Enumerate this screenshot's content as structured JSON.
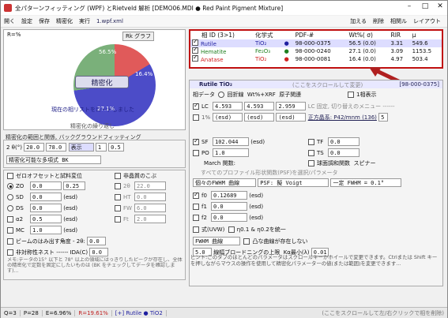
{
  "window": {
    "title": "全パターンフィッティング (WPF) とRietveld 解析 [DEMO06.MDI ● Red Paint Pigment Mixture]"
  },
  "menu": {
    "items": [
      "開く",
      "設定",
      "保存",
      "精密化",
      "実行",
      "1.wpf.xml"
    ],
    "right": [
      "加える",
      "削除",
      "相関ル",
      "レイアウト"
    ]
  },
  "left": {
    "r_label": "R=%",
    "mode": "Rk グラフ",
    "pct1": "56.5%",
    "pct2": "27.1%",
    "pct3": "16.4%",
    "refine_btn": "精密化",
    "loaded_msg": "現在の相リストをロードしました",
    "footer": "精密化の繰り返し"
  },
  "refine_section": {
    "title": "精密化の範囲と関係, バックグラウンドフィッティング",
    "theta_label": "2 θ(°)",
    "theta_from": "20.0",
    "theta_to": "78.0",
    "display_btn": "表示",
    "val1": "1",
    "val2": "0.5",
    "refine_cb": "精密化可能な多項式 BK",
    "zero_label": "ゼロオフセットと試料変位",
    "nonsym_label": "非晶質のこぶ"
  },
  "params_left": [
    {
      "name": "ZO",
      "val": "0.0",
      "val2": "0.25"
    },
    {
      "name": "SD",
      "val": "0.0",
      "val2": "(esd)"
    },
    {
      "name": "DS",
      "val": "0.0",
      "val2": "(esd)"
    },
    {
      "name": "α2",
      "val": "0.5",
      "val2": "(esd)"
    },
    {
      "name": "MC",
      "val": "1.0",
      "val2": "(esd)"
    }
  ],
  "amorph": [
    {
      "name": "2θ",
      "val": "22.0"
    },
    {
      "name": "HT",
      "val": "0.0"
    },
    {
      "name": "FW",
      "val": "6.0"
    },
    {
      "name": "Ft",
      "val": "2.0"
    }
  ],
  "beam_label": "ビームのはみ出す角度 - 2θ:",
  "beam_val": "0.0",
  "sym_label": "非対称性ネスト ------ IDA(C)",
  "sym_val": "0.0",
  "left_note": "メモ:データの15° 以下と 78° 以上の領域にはっきりしたピークが存在し、全体の精密化で定数を固定にしたいものは (BK をチェックしてデータを確認します)...",
  "phase_table": {
    "headers": [
      "相 ID (3>1)",
      "化学式",
      "",
      "PDF-#",
      "Wt%( σ)",
      "RIR",
      "μ"
    ],
    "rows": [
      {
        "name": "Rutile",
        "formula": "TiO₂",
        "pdf": "98-000-0375",
        "wt": "56.5 (0.0)",
        "rir": "3.31",
        "mu": "549.6",
        "color": "#1f1fa0"
      },
      {
        "name": "Hematite",
        "formula": "Fe₂O₃",
        "pdf": "98-000-0240",
        "wt": "27.1 (0.0)",
        "rir": "3.09",
        "mu": "1153.5",
        "color": "#1f7f1f"
      },
      {
        "name": "Anatase",
        "formula": "TiO₂",
        "pdf": "98-000-0081",
        "wt": "16.4 (0.0)",
        "rir": "4.97",
        "mu": "503.4",
        "color": "#d02020"
      }
    ]
  },
  "rpanel": {
    "phase_label": "Rutile TiO₂",
    "hint": "(ここをスクロールして変更)",
    "pdf": "[98-000-0375]",
    "tabs": [
      "相データ",
      "回折線",
      "Wt%+XRF",
      "原子関連"
    ],
    "one_display": "1相表示",
    "lc_label": "LC",
    "lc_vals": [
      "4.593",
      "4.593",
      "2.959"
    ],
    "lc_note": "LC 固定, 切り替えのメニュー ------",
    "esd": "(esd)",
    "sg": "正方晶系: P42/mnm (136)",
    "sg_n": "5",
    "sf_label": "SF",
    "sf_val": "102.044",
    "po_label": "PO",
    "po_val": "1.0",
    "tf_label": "TF",
    "tf_val": "0.0",
    "ts_label": "TS",
    "ts_val": "0.0",
    "march": "March 関数:",
    "spinel": "球面調和関数",
    "spin": "スピナー",
    "profile_title": "すべてのプロファイル形状関数(PSF)を選択/パラメータ",
    "shape_sel": "個々のFWHM 曲線",
    "psf": "PSF: 擬 Voigt",
    "fwhm": "一定 FWHM = 0.1°",
    "f_rows": [
      {
        "n": "f0",
        "v": "0.12689"
      },
      {
        "n": "f1",
        "v": "0.0"
      },
      {
        "n": "f2",
        "v": "0.0"
      }
    ],
    "uvw": "式(UVW)",
    "tt": "η0.1 & η0.2を統一",
    "fwhm_btn": "FWHM 曲線",
    "ha_label": "凸な曲線が存在しない",
    "kh_label": "狭い幅/",
    "width_val": "5.0",
    "width_label": "線幅ブロードニングの上限",
    "ksize": "Kα最小(λ)",
    "ksize_v": "0.01"
  },
  "help": "ヒント:このタブのほとんどのパラメータはスクロールキーかホイールで変更できます。Ctrlまたは Shift キーを押しながらマウスの操作を使用して精密化パラメーターの値(または範囲)を変更できます...",
  "status": {
    "q": "Q=3",
    "p": "P=28",
    "e": "E=6.96%",
    "r": "R=19.61%",
    "ph": "[+] Rutile ● TiO2",
    "tip": "(ここをスクロールして左/右クリックで相を削除)"
  }
}
